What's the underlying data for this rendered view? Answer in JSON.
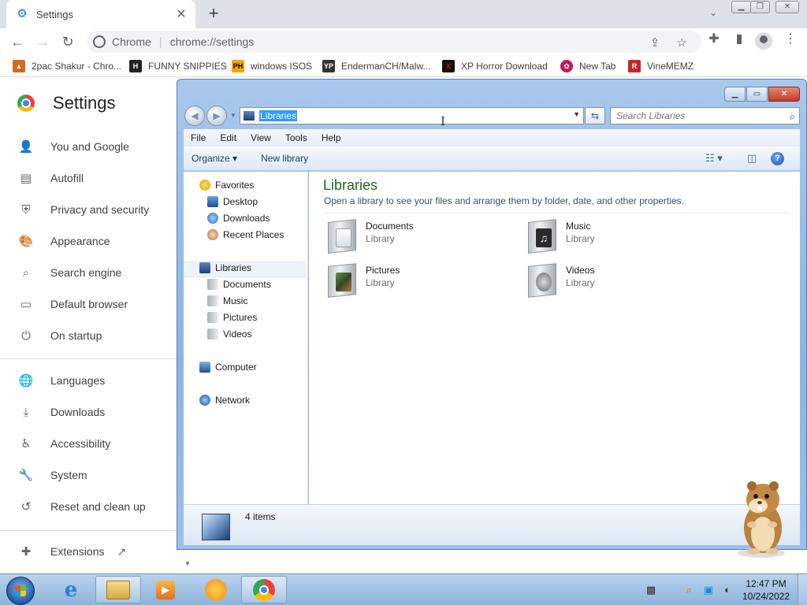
{
  "browser": {
    "tab": {
      "title": "Settings",
      "icon": "gear-icon"
    },
    "omnibox": {
      "chip": "Chrome",
      "url": "chrome://settings"
    },
    "bookmarks": [
      {
        "label": "2pac Shakur - Chro...",
        "icon": "fire-icon",
        "color": "#d66b1f"
      },
      {
        "label": "FUNNY SNIPPIES",
        "icon": "h-logo-icon",
        "color": "#222222"
      },
      {
        "label": "windows ISOS",
        "icon": "ph-logo-icon",
        "color": "#f7a600"
      },
      {
        "label": "EndermanCH/Malw...",
        "icon": "yp-logo-icon",
        "color": "#333333"
      },
      {
        "label": "XP Horror Download",
        "icon": "x-logo-icon",
        "color": "#cc0000"
      },
      {
        "label": "New Tab",
        "icon": "pinwheel-icon",
        "color": "#c2185b"
      },
      {
        "label": "VineMEMZ",
        "icon": "r-logo-icon",
        "color": "#c62828"
      }
    ]
  },
  "settings": {
    "title": "Settings",
    "nav": [
      {
        "label": "You and Google",
        "icon": "person-icon"
      },
      {
        "label": "Autofill",
        "icon": "clipboard-icon"
      },
      {
        "label": "Privacy and security",
        "icon": "shield-icon"
      },
      {
        "label": "Appearance",
        "icon": "palette-icon"
      },
      {
        "label": "Search engine",
        "icon": "search-icon"
      },
      {
        "label": "Default browser",
        "icon": "browser-window-icon"
      },
      {
        "label": "On startup",
        "icon": "power-icon"
      },
      {
        "label": "Languages",
        "icon": "globe-icon"
      },
      {
        "label": "Downloads",
        "icon": "download-icon"
      },
      {
        "label": "Accessibility",
        "icon": "accessibility-icon"
      },
      {
        "label": "System",
        "icon": "wrench-icon"
      },
      {
        "label": "Reset and clean up",
        "icon": "history-icon"
      },
      {
        "label": "Extensions",
        "icon": "puzzle-icon"
      }
    ]
  },
  "explorer": {
    "address": "Libraries",
    "search_placeholder": "Search Libraries",
    "menu": [
      "File",
      "Edit",
      "View",
      "Tools",
      "Help"
    ],
    "commands": {
      "organize": "Organize",
      "new_library": "New library"
    },
    "navpane": {
      "favorites": "Favorites",
      "favorites_items": [
        "Desktop",
        "Downloads",
        "Recent Places"
      ],
      "libraries": "Libraries",
      "libraries_items": [
        "Documents",
        "Music",
        "Pictures",
        "Videos"
      ],
      "computer": "Computer",
      "network": "Network"
    },
    "heading": "Libraries",
    "description": "Open a library to see your files and arrange them by folder, date, and other properties.",
    "items": [
      {
        "name": "Documents",
        "type": "Library"
      },
      {
        "name": "Music",
        "type": "Library"
      },
      {
        "name": "Pictures",
        "type": "Library"
      },
      {
        "name": "Videos",
        "type": "Library"
      }
    ],
    "status": "4 items"
  },
  "taskbar": {
    "time": "12:47 PM",
    "date": "10/24/2022"
  }
}
